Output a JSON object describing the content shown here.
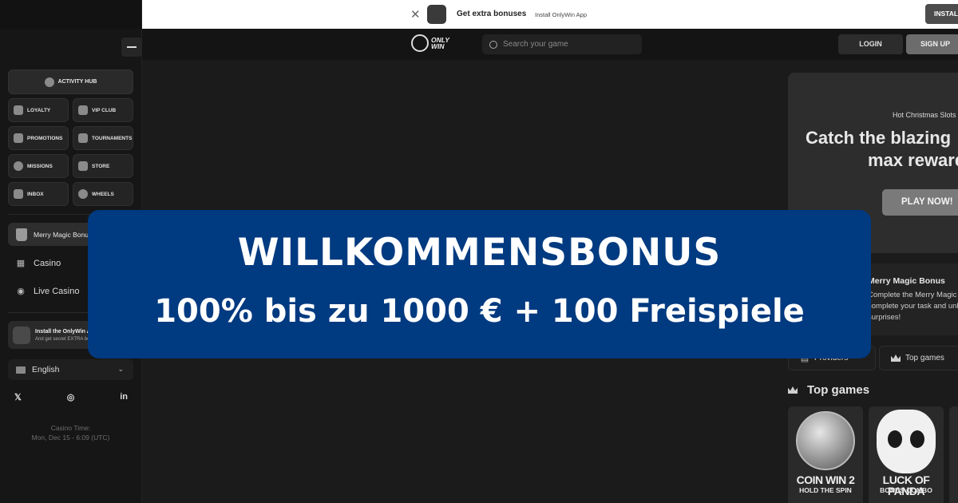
{
  "topbar": {
    "title": "Get extra bonuses",
    "subtitle": "Install OnlyWin App",
    "install_label": "INSTALL"
  },
  "header": {
    "logo_text_1": "ONLY",
    "logo_text_2": "WIN",
    "search_placeholder": "Search your game",
    "login_label": "LOGIN",
    "signup_label": "SIGN UP"
  },
  "sidebar": {
    "activity_hub": "ACTIVITY HUB",
    "grid": [
      {
        "label": "LOYALTY",
        "icon": "loyalty-icon"
      },
      {
        "label": "VIP CLUB",
        "icon": "crown-icon"
      },
      {
        "label": "PROMOTIONS",
        "icon": "gift-icon"
      },
      {
        "label": "TOURNAMENTS",
        "icon": "trophy-icon"
      },
      {
        "label": "MISSIONS",
        "icon": "rocket-icon"
      },
      {
        "label": "STORE",
        "icon": "store-icon"
      },
      {
        "label": "INBOX",
        "icon": "inbox-icon"
      },
      {
        "label": "WHEELS",
        "icon": "wheel-icon"
      }
    ],
    "merry": "Merry Magic Bonus",
    "casino": "Casino",
    "live_casino": "Live Casino",
    "install_title": "Install the OnlyWin App",
    "install_sub": "And get secret EXTRA bonuses",
    "language": "English",
    "social": {
      "x": "𝕏",
      "instagram": "◎",
      "linkedin": "in"
    },
    "casino_time_label": "Casino Time:",
    "casino_time_value": "Mon, Dec 15 - 6:09 (UTC)"
  },
  "promo": {
    "kicker": "Hot Christmas Slots",
    "headline_1": "Catch the blazing",
    "headline_2": "max rewards",
    "play_label": "PLAY NOW!"
  },
  "mission": {
    "title": "Merry Magic Bonus",
    "line_1": "Complete the Merry Magic Bonus mission",
    "line_2": "complete your task and unlock",
    "line_3": "surprises!"
  },
  "tabs": {
    "providers": "Providers",
    "top_games": "Top games"
  },
  "top_games": {
    "title": "Top games",
    "tiles": [
      {
        "name": "COIN WIN 2",
        "sub": "HOLD THE SPIN"
      },
      {
        "name": "LUCK OF PANDA",
        "sub": "BONUS COMBO"
      }
    ]
  },
  "banner": {
    "title": "WILLKOMMENSBONUS",
    "subtitle": "100% bis zu 1000 € + 100 Freispiele",
    "color": "#003a80"
  }
}
